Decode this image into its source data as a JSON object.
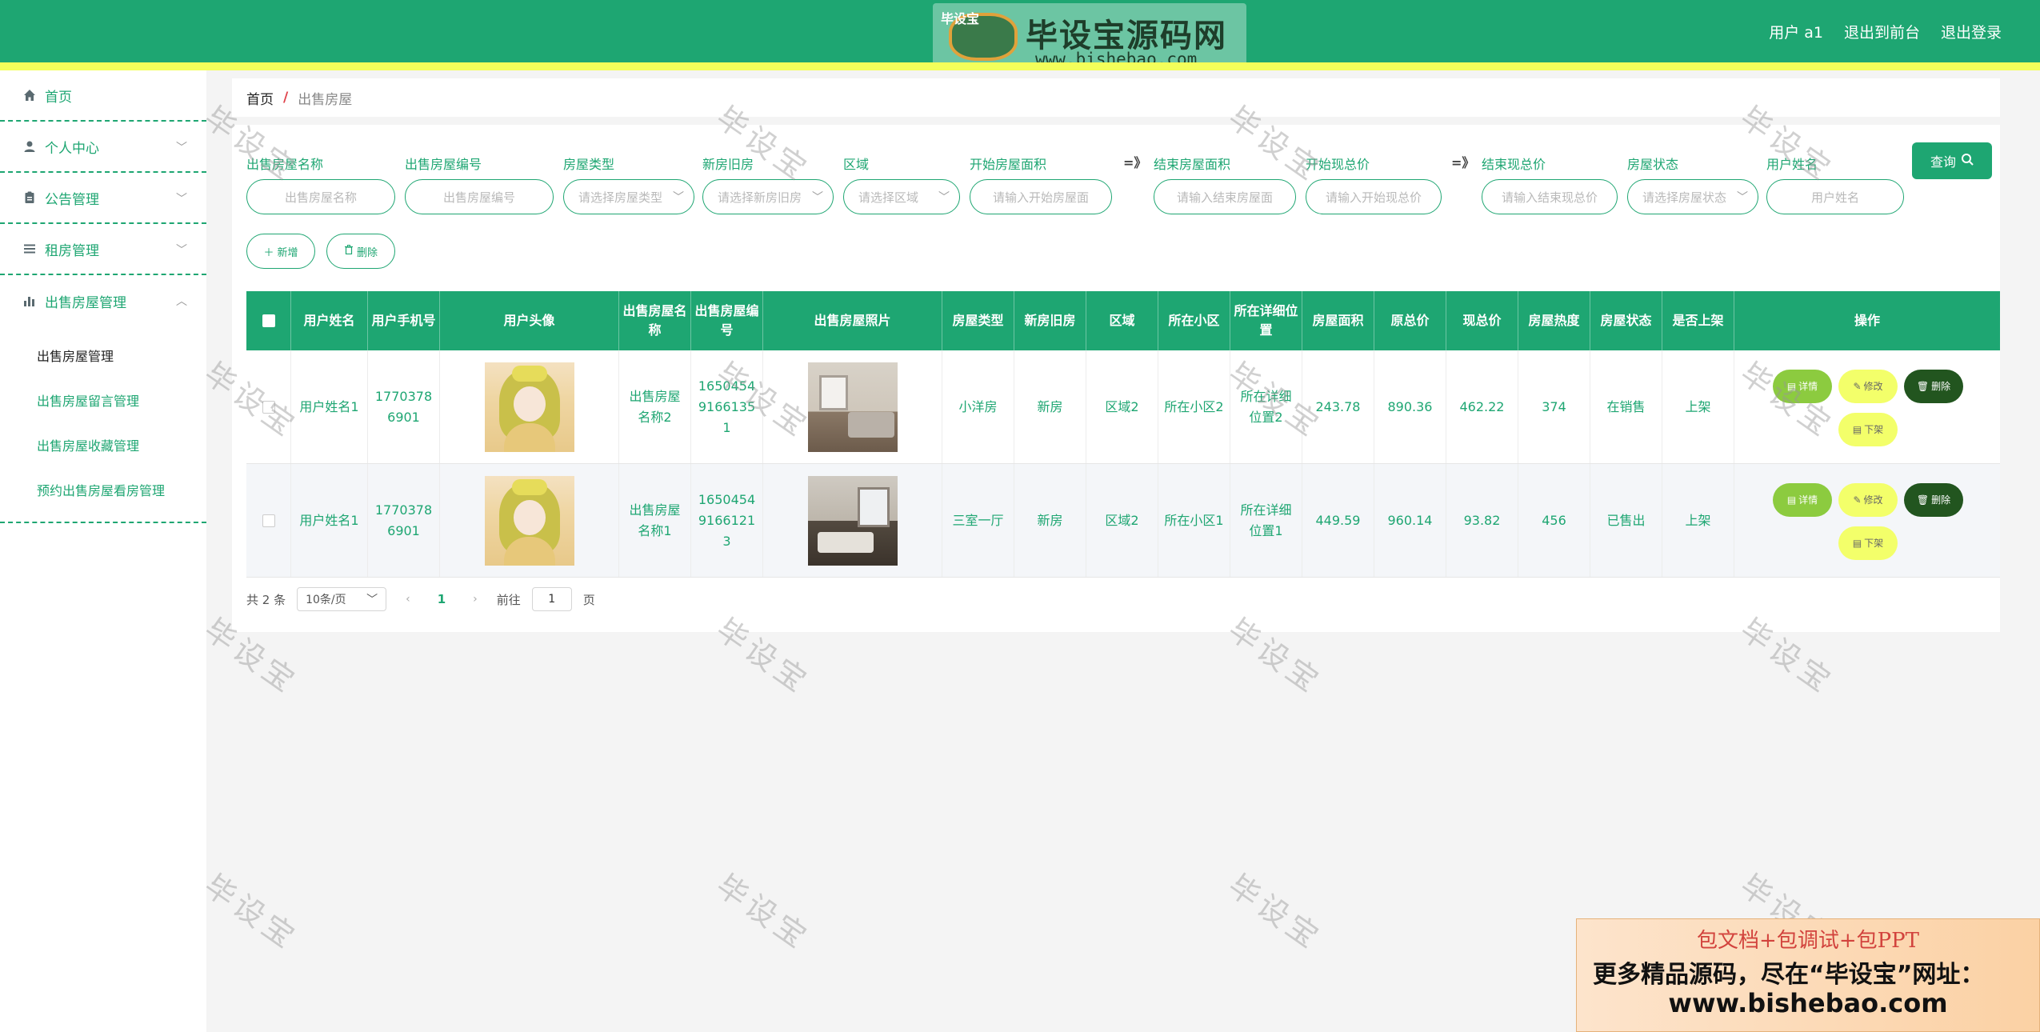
{
  "header": {
    "logo_text": "毕设宝源码网",
    "logo_url": "www.bishebao.com",
    "logo_badge": "毕设宝",
    "user_label": "用户 a1",
    "back_to_front": "退出到前台",
    "logout": "退出登录"
  },
  "sidebar": {
    "items": [
      {
        "label": "首页"
      },
      {
        "label": "个人中心"
      },
      {
        "label": "公告管理"
      },
      {
        "label": "租房管理"
      },
      {
        "label": "出售房屋管理"
      }
    ],
    "submenu": [
      {
        "label": "出售房屋管理"
      },
      {
        "label": "出售房屋留言管理"
      },
      {
        "label": "出售房屋收藏管理"
      },
      {
        "label": "预约出售房屋看房管理"
      }
    ]
  },
  "breadcrumb": {
    "home": "首页",
    "sep": "/",
    "current": "出售房屋"
  },
  "filters": {
    "house_name": {
      "label": "出售房屋名称",
      "placeholder": "出售房屋名称"
    },
    "house_no": {
      "label": "出售房屋编号",
      "placeholder": "出售房屋编号"
    },
    "house_type": {
      "label": "房屋类型",
      "placeholder": "请选择房屋类型"
    },
    "new_old": {
      "label": "新房旧房",
      "placeholder": "请选择新房旧房"
    },
    "area": {
      "label": "区域",
      "placeholder": "请选择区域"
    },
    "start_size": {
      "label": "开始房屋面积",
      "placeholder": "请输入开始房屋面"
    },
    "end_size": {
      "label": "结束房屋面积",
      "placeholder": "请输入结束房屋面"
    },
    "start_price": {
      "label": "开始现总价",
      "placeholder": "请输入开始现总价"
    },
    "end_price": {
      "label": "结束现总价",
      "placeholder": "请输入结束现总价"
    },
    "status": {
      "label": "房屋状态",
      "placeholder": "请选择房屋状态"
    },
    "user_name": {
      "label": "用户姓名",
      "placeholder": "用户姓名"
    },
    "range_arrow": "=》",
    "query_label": "查询"
  },
  "actions": {
    "add": "新增",
    "delete": "删除"
  },
  "table": {
    "headers": [
      "用户姓名",
      "用户手机号",
      "用户头像",
      "出售房屋名称",
      "出售房屋编号",
      "出售房屋照片",
      "房屋类型",
      "新房旧房",
      "区域",
      "所在小区",
      "所在详细位置",
      "房屋面积",
      "原总价",
      "现总价",
      "房屋热度",
      "房屋状态",
      "是否上架",
      "操作"
    ],
    "rows": [
      {
        "user_name": "用户姓名1",
        "phone": "17703786901",
        "house_name": "出售房屋名称2",
        "house_no": "16504549166135 1",
        "house_type": "小洋房",
        "new_old": "新房",
        "area": "区域2",
        "community": "所在小区2",
        "location": "所在详细位置2",
        "size": "243.78",
        "orig_price": "890.36",
        "cur_price": "462.22",
        "heat": "374",
        "status": "在销售",
        "listed": "上架"
      },
      {
        "user_name": "用户姓名1",
        "phone": "17703786901",
        "house_name": "出售房屋名称1",
        "house_no": "16504549166121 3",
        "house_type": "三室一厅",
        "new_old": "新房",
        "area": "区域2",
        "community": "所在小区1",
        "location": "所在详细位置1",
        "size": "449.59",
        "orig_price": "960.14",
        "cur_price": "93.82",
        "heat": "456",
        "status": "已售出",
        "listed": "上架"
      }
    ],
    "ops": {
      "detail": "详情",
      "edit": "修改",
      "delete": "删除",
      "off": "下架"
    }
  },
  "pager": {
    "total": "共 2 条",
    "page_size": "10条/页",
    "current": "1",
    "goto_label": "前往",
    "goto_value": "1",
    "page_unit": "页"
  },
  "watermark": "毕设宝",
  "promo": {
    "line1": "包文档+包调试+包PPT",
    "line2": "更多精品源码，尽在“毕设宝”网址：",
    "line3": "www.bishebao.com"
  },
  "colors": {
    "primary": "#1ea672",
    "stripe": "#f3ff5a",
    "detail": "#8ccb3f",
    "edit": "#f3ff6a",
    "delete": "#22551f"
  }
}
